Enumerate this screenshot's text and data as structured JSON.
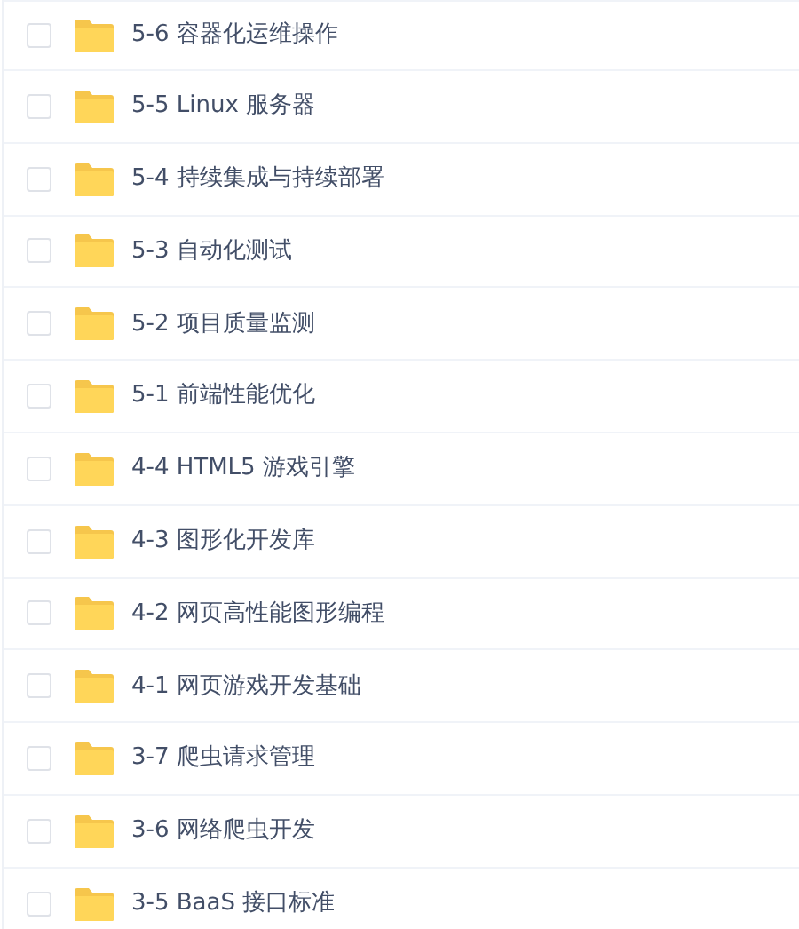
{
  "files": [
    {
      "name": "5-6 容器化运维操作",
      "checked": false
    },
    {
      "name": "5-5 Linux 服务器",
      "checked": false
    },
    {
      "name": "5-4 持续集成与持续部署",
      "checked": false
    },
    {
      "name": "5-3 自动化测试",
      "checked": false
    },
    {
      "name": "5-2 项目质量监测",
      "checked": false
    },
    {
      "name": "5-1 前端性能优化",
      "checked": false
    },
    {
      "name": "4-4 HTML5 游戏引擎",
      "checked": false
    },
    {
      "name": "4-3 图形化开发库",
      "checked": false
    },
    {
      "name": "4-2 网页高性能图形编程",
      "checked": false
    },
    {
      "name": "4-1 网页游戏开发基础",
      "checked": false
    },
    {
      "name": "3-7 爬虫请求管理",
      "checked": false
    },
    {
      "name": "3-6 网络爬虫开发",
      "checked": false
    },
    {
      "name": "3-5 BaaS 接口标准",
      "checked": false
    }
  ]
}
